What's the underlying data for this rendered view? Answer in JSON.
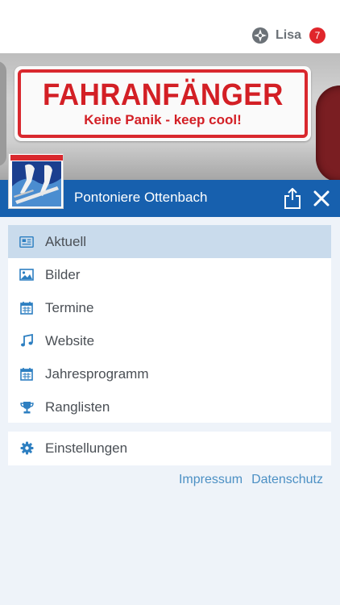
{
  "header": {
    "user_name": "Lisa",
    "notification_count": "7",
    "user_icon": "fire-kitchen-cross-icon",
    "accent_color": "#1760ae",
    "badge_color": "#e0262b"
  },
  "hero": {
    "sign_title": "FAHRANFÄNGER",
    "sign_subtitle": "Keine Panik - keep cool!",
    "logo_caption": "Pontoniere Ottenbach"
  },
  "club": {
    "name": "Pontoniere Ottenbach",
    "share_icon": "share-icon",
    "close_icon": "close-icon"
  },
  "menu": {
    "items": [
      {
        "label": "Aktuell",
        "icon": "newspaper-icon",
        "active": true
      },
      {
        "label": "Bilder",
        "icon": "image-icon",
        "active": false
      },
      {
        "label": "Termine",
        "icon": "calendar-icon",
        "active": false
      },
      {
        "label": "Website",
        "icon": "music-note-icon",
        "active": false
      },
      {
        "label": "Jahresprogramm",
        "icon": "calendar-icon",
        "active": false
      },
      {
        "label": "Ranglisten",
        "icon": "trophy-icon",
        "active": false
      }
    ],
    "settings": {
      "label": "Einstellungen",
      "icon": "gear-icon"
    }
  },
  "footer": {
    "impressum": "Impressum",
    "datenschutz": "Datenschutz"
  }
}
